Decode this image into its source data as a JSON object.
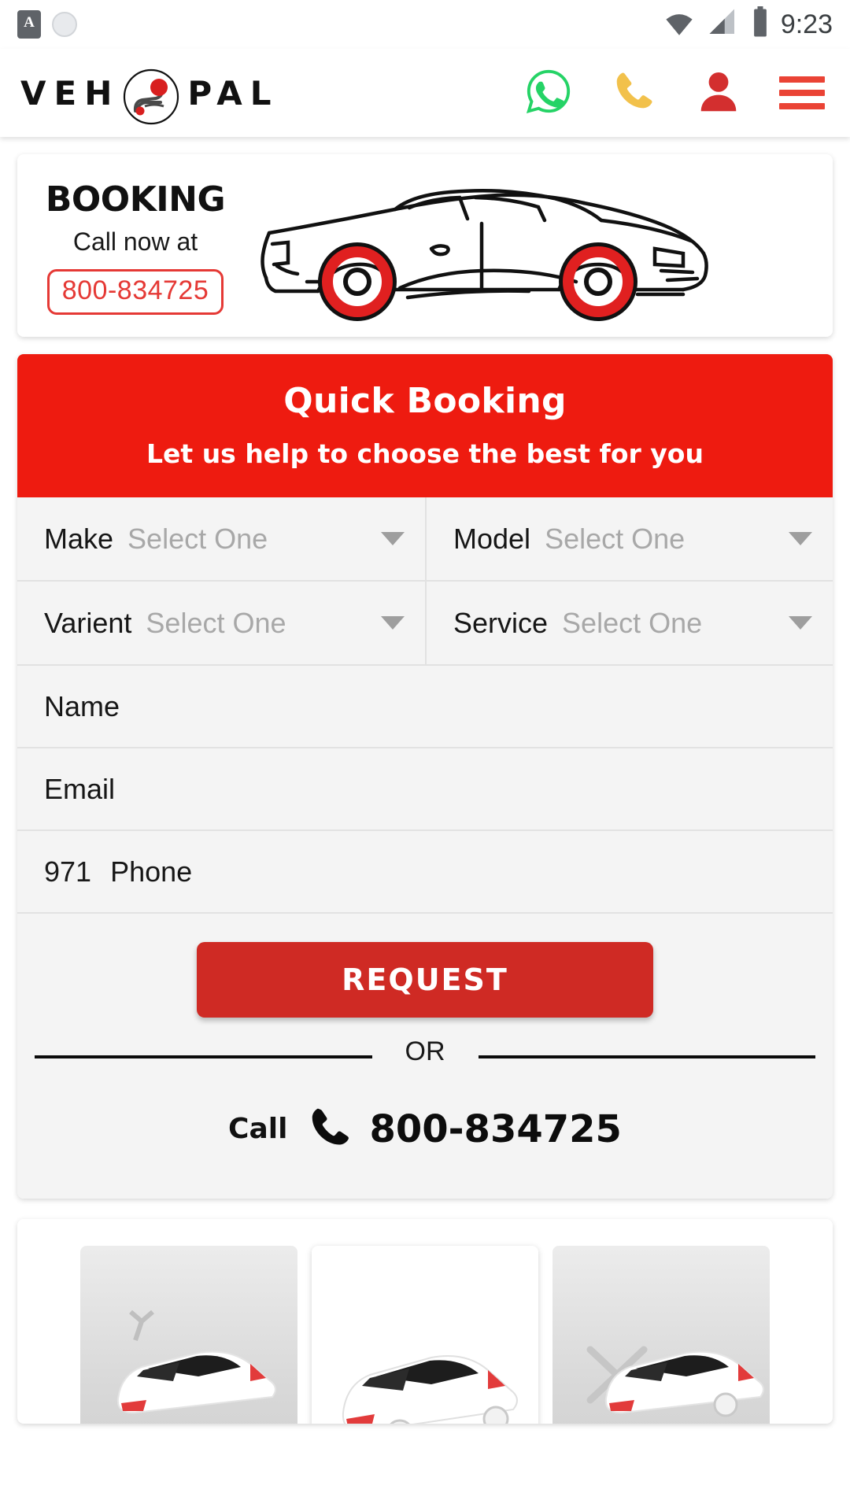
{
  "statusbar": {
    "left_icons": [
      "font-size-icon",
      "dial-icon"
    ],
    "font_icon_label": "A",
    "right_icons": [
      "wifi-icon",
      "signal-icon",
      "battery-icon"
    ],
    "time": "9:23"
  },
  "appbar": {
    "logo_text_left": "VEH",
    "logo_text_right": "PAL",
    "icons": [
      "whatsapp-icon",
      "phone-call-icon",
      "user-account-icon",
      "hamburger-menu-icon"
    ],
    "colors": {
      "whatsapp_green": "#25D366",
      "phone_yellow": "#F2C14B",
      "user_red": "#D32F2F",
      "hamburger_red": "#EA4335"
    }
  },
  "banner": {
    "title": "BOOKING",
    "subtitle": "Call now at",
    "phone": "800-834725",
    "phone_color": "#E53935",
    "car_illustration": "sports-car-line-art"
  },
  "quick_booking": {
    "header_title": "Quick Booking",
    "header_subtitle": "Let us help to choose the best for you",
    "header_bg": "#EE1B10",
    "fields": [
      {
        "label": "Make",
        "value": "Select One",
        "type": "dropdown"
      },
      {
        "label": "Model",
        "value": "Select One",
        "type": "dropdown"
      },
      {
        "label": "Varient",
        "value": "Select One",
        "type": "dropdown"
      },
      {
        "label": "Service",
        "value": "Select One",
        "type": "dropdown"
      }
    ],
    "name_label": "Name",
    "email_label": "Email",
    "phone_code": "971",
    "phone_label": "Phone",
    "request_label": "REQUEST",
    "request_bg": "#CF2A24",
    "or_label": "OR",
    "call_label": "Call",
    "call_number": "800-834725",
    "call_icon": "phone-handset-icon"
  },
  "gallery": {
    "tiles": [
      "car-service-image-1",
      "car-service-image-2",
      "car-service-image-3"
    ]
  }
}
